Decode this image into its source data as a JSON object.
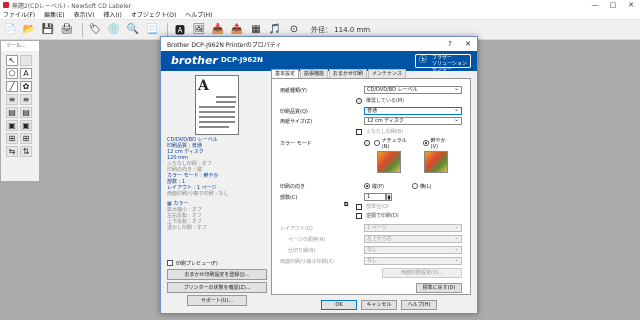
{
  "window": {
    "title": "無題2(CDレーベル) - NewSoft CD Labeler",
    "controls": [
      "—",
      "□",
      "✕"
    ]
  },
  "menu": [
    "ファイル(F)",
    "編集(E)",
    "表示(V)",
    "挿入(I)",
    "オブジェクト(O)",
    "ヘルプ(H)"
  ],
  "toolbar": {
    "outer_label": "外径： 114.0 mm"
  },
  "palette": {
    "title": "ツール..."
  },
  "dialog": {
    "title": "Brother DCP-J962N Printerのプロパティ",
    "help": "?",
    "close": "✕",
    "brand": "brother",
    "model": "DCP-J962N",
    "solution_line1": "ブラザー",
    "solution_line2": "ソリューションセンター",
    "preview_letter": "A",
    "summary_blue": [
      "CD/DVD/BD レーベル",
      "印刷品質 : 普通",
      "12 cm ディスク",
      "120 mm"
    ],
    "summary_gray1": [
      "ふちなし印刷 : オフ",
      "印刷の向き : 縦"
    ],
    "summary_blue2": [
      "カラー モード : 鮮やか",
      "部数 : 1",
      "レイアウト : 1 ページ"
    ],
    "summary_gray2": [
      "両面印刷/小冊子印刷 : なし"
    ],
    "summary_color_header": "カラー",
    "summary_gray3": [
      "拡大縮小 : オフ",
      "左右反転 : オフ",
      "上下反転 : オフ",
      "透かし印刷 : オフ"
    ],
    "print_preview_label": "印刷プレビュー(F)",
    "btn_add_profile": "おまかせ印刷設定を登録(J)...",
    "btn_printer_status": "プリンターの状態を確認(Z)...",
    "btn_support": "サポート(U)...",
    "tabs": [
      "基本設定",
      "拡張機能",
      "おまかせ印刷",
      "メンテナンス"
    ],
    "media_label": "用紙種類(Y)",
    "media_value": "CD/DVD/BD レーベル",
    "media_note": "推奨している(M)",
    "quality_label": "印刷品質(Q)",
    "quality_value": "普通",
    "size_label": "用紙サイズ(Z)",
    "size_value": "12 cm ディスク",
    "borderless_label": "ふちなし印刷(B)",
    "color_mode_label": "カラー モード",
    "color_natural": "ナチュラル(N)",
    "color_vivid": "鮮やか(V)",
    "orientation_label": "印刷の向き",
    "portrait": "縦(P)",
    "landscape": "横(L)",
    "copies_label": "部数(C)",
    "copies_value": "1",
    "collate_label": "部単位(O)",
    "reverse_label": "逆順で印刷(D)",
    "layout_label": "レイアウト(G)",
    "layout_value": "1 ページ",
    "page_order_label": "ページの順序(R)",
    "page_order_value": "左上から右",
    "border_label": "仕切り線(B)",
    "border_value": "なし",
    "duplex_label": "両面印刷/小冊子印刷(X)",
    "duplex_value": "なし",
    "duplex_settings": "両面印刷設定(X)...",
    "default_btn": "標準に戻す(D)",
    "ok": "OK",
    "cancel": "キャンセル",
    "help_btn": "ヘルプ(H)"
  }
}
